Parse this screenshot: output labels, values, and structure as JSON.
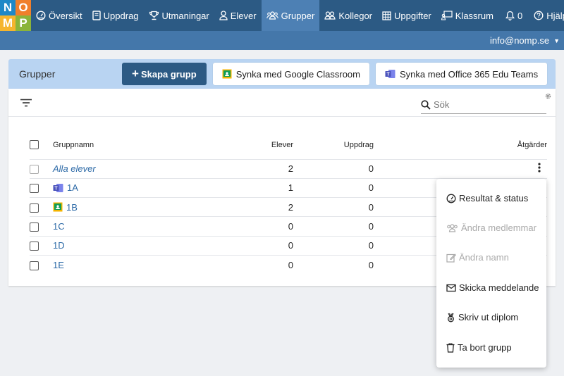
{
  "logo": {
    "letters": [
      "N",
      "O",
      "M",
      "P"
    ],
    "colors": [
      "#1e88c7",
      "#f07f2b",
      "#f5b52e",
      "#8bb43a"
    ]
  },
  "nav": {
    "items": [
      {
        "label": "Översikt",
        "icon": "gauge-icon",
        "active": false
      },
      {
        "label": "Uppdrag",
        "icon": "book-icon",
        "active": false
      },
      {
        "label": "Utmaningar",
        "icon": "trophy-icon",
        "active": false
      },
      {
        "label": "Elever",
        "icon": "user-icon",
        "active": false
      },
      {
        "label": "Grupper",
        "icon": "users-icon",
        "active": true
      },
      {
        "label": "Kollegor",
        "icon": "colleagues-icon",
        "active": false
      },
      {
        "label": "Uppgifter",
        "icon": "grid-icon",
        "active": false
      },
      {
        "label": "Klassrum",
        "icon": "classroom-icon",
        "active": false
      }
    ],
    "notifications": "0",
    "help": "Hjälp"
  },
  "account": {
    "email": "info@nomp.se"
  },
  "header": {
    "title": "Grupper",
    "create_label": "Skapa grupp",
    "google_label": "Synka med Google Classroom",
    "office_label": "Synka med Office 365 Edu Teams"
  },
  "search": {
    "placeholder": "Sök"
  },
  "table": {
    "columns": {
      "name": "Gruppnamn",
      "students": "Elever",
      "tasks": "Uppdrag",
      "actions": "Åtgärder"
    },
    "rows": [
      {
        "name": "Alla elever",
        "students": "2",
        "tasks": "0",
        "source": "all"
      },
      {
        "name": "1A",
        "students": "1",
        "tasks": "0",
        "source": "office"
      },
      {
        "name": "1B",
        "students": "2",
        "tasks": "0",
        "source": "google"
      },
      {
        "name": "1C",
        "students": "0",
        "tasks": "0",
        "source": "none"
      },
      {
        "name": "1D",
        "students": "0",
        "tasks": "0",
        "source": "none"
      },
      {
        "name": "1E",
        "students": "0",
        "tasks": "0",
        "source": "none"
      }
    ]
  },
  "menu": {
    "items": [
      {
        "label": "Resultat & status",
        "icon": "gauge-icon",
        "enabled": true
      },
      {
        "label": "Ändra medlemmar",
        "icon": "users-icon",
        "enabled": false
      },
      {
        "label": "Ändra namn",
        "icon": "edit-icon",
        "enabled": false
      },
      {
        "label": "Skicka meddelande",
        "icon": "envelope-icon",
        "enabled": true
      },
      {
        "label": "Skriv ut diplom",
        "icon": "medal-icon",
        "enabled": true
      },
      {
        "label": "Ta bort grupp",
        "icon": "trash-icon",
        "enabled": true
      }
    ]
  },
  "colors": {
    "nav_bg": "#2c5a84",
    "nav_active": "#4d80b4",
    "subbar": "#4477aa",
    "header_bg": "#b9d4f2",
    "link": "#2d6aa7"
  }
}
